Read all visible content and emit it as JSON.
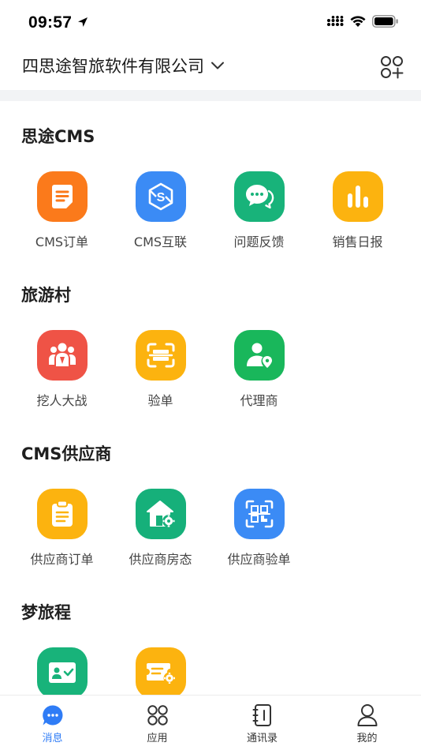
{
  "status_bar": {
    "time": "09:57"
  },
  "header": {
    "company": "四思途智旅软件有限公司"
  },
  "sections": [
    {
      "title": "思途CMS",
      "apps": [
        {
          "label": "CMS订单",
          "icon": "document-icon",
          "color": "#fb7a1b"
        },
        {
          "label": "CMS互联",
          "icon": "interconnect-icon",
          "color": "#3b8bf5"
        },
        {
          "label": "问题反馈",
          "icon": "chat-bubbles-icon",
          "color": "#18b37a"
        },
        {
          "label": "销售日报",
          "icon": "bar-chart-icon",
          "color": "#fcb30f"
        }
      ]
    },
    {
      "title": "旅游村",
      "apps": [
        {
          "label": "挖人大战",
          "icon": "team-icon",
          "color": "#ef5346"
        },
        {
          "label": "验单",
          "icon": "scan-icon",
          "color": "#fcb30f"
        },
        {
          "label": "代理商",
          "icon": "agent-location-icon",
          "color": "#19b75b"
        }
      ]
    },
    {
      "title": "CMS供应商",
      "apps": [
        {
          "label": "供应商订单",
          "icon": "clipboard-icon",
          "color": "#fcb30f"
        },
        {
          "label": "供应商房态",
          "icon": "house-settings-icon",
          "color": "#16b07a"
        },
        {
          "label": "供应商验单",
          "icon": "qr-scan-icon",
          "color": "#3b8bf5"
        }
      ]
    },
    {
      "title": "梦旅程",
      "apps": [
        {
          "label": "",
          "icon": "id-card-check-icon",
          "color": "#18b37a"
        },
        {
          "label": "",
          "icon": "ticket-settings-icon",
          "color": "#fcb30f"
        }
      ]
    }
  ],
  "tabbar": {
    "tabs": [
      {
        "label": "消息",
        "icon": "message-icon"
      },
      {
        "label": "应用",
        "icon": "apps-grid-icon"
      },
      {
        "label": "通讯录",
        "icon": "contacts-book-icon"
      },
      {
        "label": "我的",
        "icon": "person-icon"
      }
    ],
    "active_color": "#2f7cf6"
  }
}
